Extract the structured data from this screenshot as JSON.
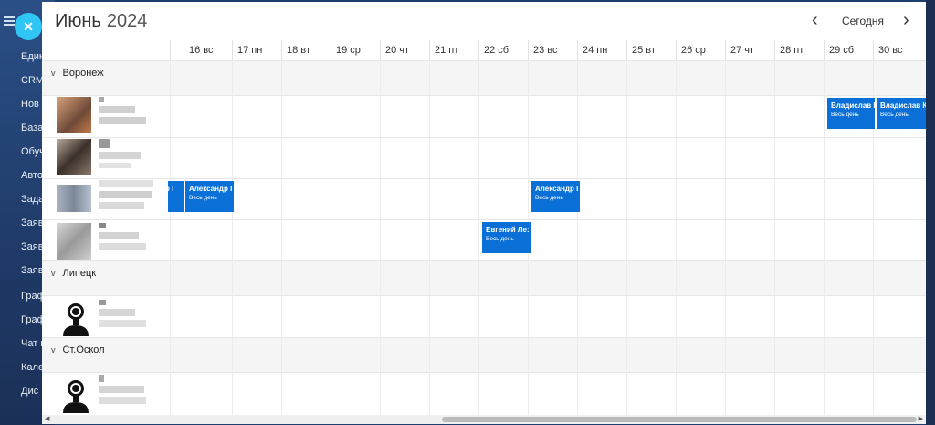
{
  "sidebar": {
    "items": [
      "Един",
      "CRM",
      "Нов",
      "База",
      "Обуч",
      "Авто",
      "Зада",
      "Заяв",
      "Заяв",
      "Заяв",
      "Граф",
      "Граф",
      "Чат и",
      "Кале",
      "Дис"
    ]
  },
  "header": {
    "month": "Июнь",
    "year": "2024",
    "today_label": "Сегодня",
    "prev_icon": "chevron-left-icon",
    "next_icon": "chevron-right-icon"
  },
  "days": [
    "16 вс",
    "17 пн",
    "18 вт",
    "19 ср",
    "20 чт",
    "21 пт",
    "22 сб",
    "23 вс",
    "24 пн",
    "25 вт",
    "26 ср",
    "27 чт",
    "28 пт",
    "29 сб",
    "30 вс"
  ],
  "groups": [
    {
      "label": "Воронеж"
    },
    {
      "label": "Липецк"
    },
    {
      "label": "Ст.Оскол"
    }
  ],
  "events": [
    {
      "name": "Владислав К",
      "sub": "Весь день"
    },
    {
      "name": "Владислав К",
      "sub": "Весь день"
    },
    {
      "name": "Александр I",
      "sub": "Весь день"
    },
    {
      "name": "Александр I",
      "sub": "Весь день"
    },
    {
      "name": "Александр I",
      "sub": "Весь день"
    },
    {
      "name": "Евгений Ле:",
      "sub": "Весь день"
    }
  ],
  "colors": {
    "event": "#0a6fd6",
    "close_button": "#2fc6f6",
    "sidebar": "#1f3a67"
  }
}
